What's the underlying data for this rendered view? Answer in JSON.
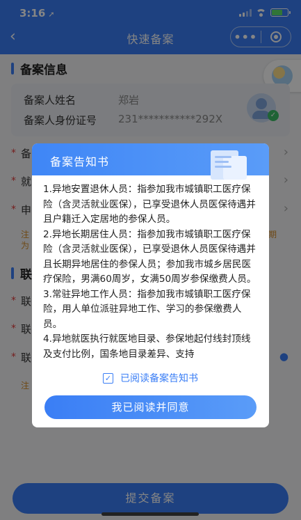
{
  "status_bar": {
    "time": "3:16",
    "location_arrow": "➚"
  },
  "nav": {
    "back": "‹",
    "title": "快速备案",
    "more": "•••"
  },
  "info_section": {
    "title": "备案信息",
    "name_label": "备案人姓名",
    "name_value": "郑岩",
    "id_label": "备案人身份证号",
    "id_value": "231***********292X"
  },
  "form_rows": [
    {
      "label": "备"
    },
    {
      "label": "就"
    },
    {
      "label": "申"
    }
  ],
  "notes": {
    "note1_a": "注",
    "note1_b": "为",
    "note1_right": "期",
    "note2": "注"
  },
  "contact_section": {
    "title": "联",
    "rows": [
      {
        "label": "联"
      },
      {
        "label": "联"
      },
      {
        "label": "联"
      }
    ]
  },
  "submit_label": "提交备案",
  "modal": {
    "title": "备案告知书",
    "paragraphs": [
      "1.异地安置退休人员：指参加我市城镇职工医疗保险（含灵活就业医保），已享受退休人员医保待遇并且户籍迁入定居地的参保人员。",
      "2.异地长期居住人员：指参加我市城镇职工医疗保险（含灵活就业医保），已享受退休人员医保待遇并且长期异地居住的参保人员；参加我市城乡居民医疗保险，男满60周岁，女满50周岁参保缴费人员。",
      "3.常驻异地工作人员：指参加我市城镇职工医疗保险，用人单位派驻异地工作、学习的参保缴费人员。",
      "4.异地就医执行就医地目录、参保地起付线封顶线及支付比例，国条地目录差异、支持"
    ],
    "agree_text": "已阅读备案告知书",
    "agree_button": "我已阅读并同意"
  }
}
